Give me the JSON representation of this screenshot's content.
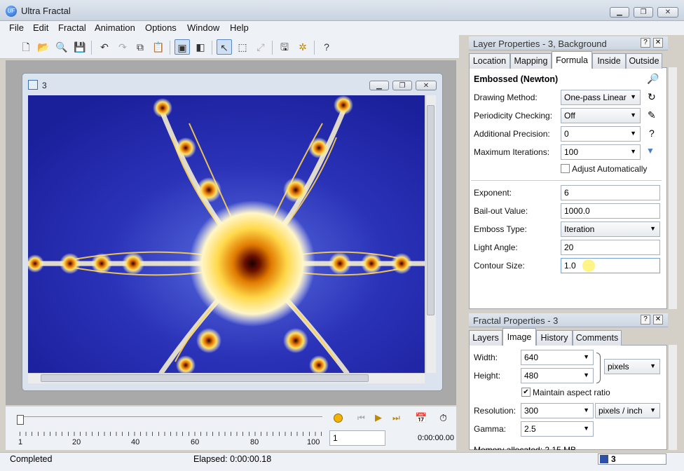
{
  "window": {
    "title": "Ultra Fractal",
    "icon_text": "UF"
  },
  "menu": [
    "File",
    "Edit",
    "Fractal",
    "Animation",
    "Options",
    "Window",
    "Help"
  ],
  "child_window": {
    "title": "3"
  },
  "timeline": {
    "ticks": [
      "1",
      "20",
      "40",
      "60",
      "80",
      "100"
    ],
    "frame_value": "1",
    "time": "0:00:00.00"
  },
  "status": {
    "left": "Completed",
    "elapsed": "Elapsed: 0:00:00.18",
    "layer_tag": "3"
  },
  "layer_panel": {
    "title": "Layer Properties - 3, Background",
    "tabs": [
      "Location",
      "Mapping",
      "Formula",
      "Inside",
      "Outside"
    ],
    "selected_tab": "Formula",
    "formula_name": "Embossed (Newton)",
    "rows": [
      {
        "label": "Drawing Method:",
        "value": "One-pass Linear"
      },
      {
        "label": "Periodicity Checking:",
        "value": "Off"
      },
      {
        "label": "Additional Precision:",
        "value": "0"
      },
      {
        "label": "Maximum Iterations:",
        "value": "100"
      }
    ],
    "adjust_auto": "Adjust Automatically",
    "params": [
      {
        "label": "Exponent:",
        "value": "6"
      },
      {
        "label": "Bail-out Value:",
        "value": "1000.0"
      },
      {
        "label": "Emboss Type:",
        "value": "Iteration"
      },
      {
        "label": "Light Angle:",
        "value": "20"
      },
      {
        "label": "Contour Size:",
        "value": "1.0"
      }
    ]
  },
  "fractal_panel": {
    "title": "Fractal Properties - 3",
    "tabs": [
      "Layers",
      "Image",
      "History",
      "Comments"
    ],
    "selected_tab": "Image",
    "width_label": "Width:",
    "width": "640",
    "height_label": "Height:",
    "height": "480",
    "units": "pixels",
    "maintain": "Maintain aspect ratio",
    "resolution_label": "Resolution:",
    "resolution": "300",
    "res_units": "pixels / inch",
    "gamma_label": "Gamma:",
    "gamma": "2.5",
    "memory": "Memory allocated:   2.15 MB"
  }
}
